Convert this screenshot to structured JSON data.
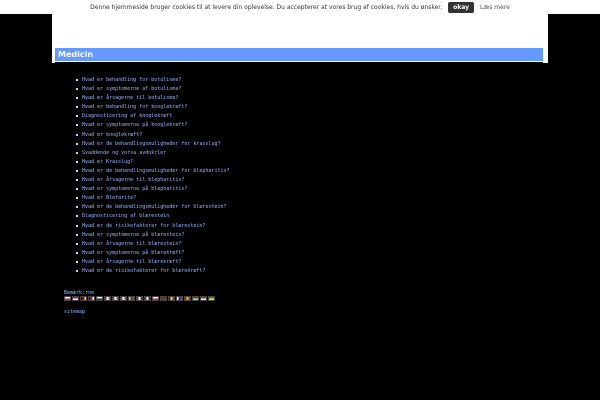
{
  "cookie": {
    "message": "Denne hjemmeside bruger cookies til at levere din oplevelse. Du accepterer at vores brug af cookies, hvis du ønsker.",
    "ok_label": "okay",
    "more_label": "Læs mere"
  },
  "page": {
    "title": "Medicin"
  },
  "links": [
    "Hvad er behandling for botulisme?",
    "Hvad er symptomerne af botulisme?",
    "Hvad er årsagerne til botulisme?",
    "Hvad er behandling for knoglekræft?",
    "Diagnosticering af knoglekræft",
    "Hvad er symptomerne på knoglekræft?",
    "Hvad er knoglekræft?",
    "Hvad er de behandlingsmuligheder for krasslug?",
    "Svaddende og vorsa avdokrler",
    "Hvad er Krasslug?",
    "Hvad er de behandlingsmuligheder for blepharitis?",
    "Hvad er årsagerne til blepharitis?",
    "Hvad er symptomerne på blepharitis?",
    "Hvad er Blefarite?",
    "Hvad er de behandlingsmuligheder for blærestein?",
    "Diagnosticering af blærestein",
    "Hvad er de risikofaktorer for blærestein?",
    "Hvad er symptomerne på blærestein?",
    "Hvad er årsagerne til blærestein?",
    "Hvad er symptomerne på blærekræft?",
    "Hvad er årsagerne til blærekræft?",
    "Hvad er de risikofaktorer for blærekræft?"
  ],
  "languages": {
    "label": "Bemærk:rne",
    "flags": [
      {
        "name": "pl-flag",
        "colors": [
          "#ffffff",
          "#dc143c"
        ]
      },
      {
        "name": "dk-flag",
        "colors": [
          "#c60c30",
          "#ffffff"
        ]
      },
      {
        "name": "de-flag",
        "colors": [
          "#000000",
          "#dd0000",
          "#ffce00"
        ]
      },
      {
        "name": "uk-flag",
        "colors": [
          "#012169",
          "#c8102e",
          "#ffffff"
        ]
      },
      {
        "name": "fi-flag",
        "colors": [
          "#ffffff",
          "#003580"
        ]
      },
      {
        "name": "fr-flag",
        "colors": [
          "#0055a4",
          "#ffffff",
          "#ef4135"
        ]
      },
      {
        "name": "hu-flag",
        "colors": [
          "#ce2939",
          "#ffffff",
          "#477050"
        ]
      },
      {
        "name": "it-flag",
        "colors": [
          "#009246",
          "#ffffff",
          "#ce2b37"
        ]
      },
      {
        "name": "lt-flag",
        "colors": [
          "#fdb913",
          "#006a44",
          "#c1272d"
        ]
      },
      {
        "name": "nl-flag",
        "colors": [
          "#ae1c28",
          "#ffffff",
          "#21468b"
        ]
      },
      {
        "name": "no-flag",
        "colors": [
          "#ba0c2f",
          "#ffffff",
          "#00205b"
        ]
      },
      {
        "name": "pl2-flag",
        "colors": [
          "#ffffff",
          "#dc143c"
        ]
      },
      {
        "name": "pt-flag",
        "colors": [
          "#006600",
          "#ff0000"
        ]
      },
      {
        "name": "ro-flag",
        "colors": [
          "#002b7f",
          "#fcd116",
          "#ce1126"
        ]
      },
      {
        "name": "ru-flag",
        "colors": [
          "#ffffff",
          "#0039a6",
          "#d52b1e"
        ]
      },
      {
        "name": "es-flag",
        "colors": [
          "#aa151b",
          "#f1bf00",
          "#aa151b"
        ]
      },
      {
        "name": "se-flag",
        "colors": [
          "#006aa7",
          "#fecc00"
        ]
      },
      {
        "name": "tr-flag",
        "colors": [
          "#e30a17",
          "#ffffff"
        ]
      },
      {
        "name": "br-flag",
        "colors": [
          "#009c3b",
          "#ffdf00"
        ]
      }
    ]
  },
  "footer": {
    "sitemap_label": "sitemap"
  }
}
